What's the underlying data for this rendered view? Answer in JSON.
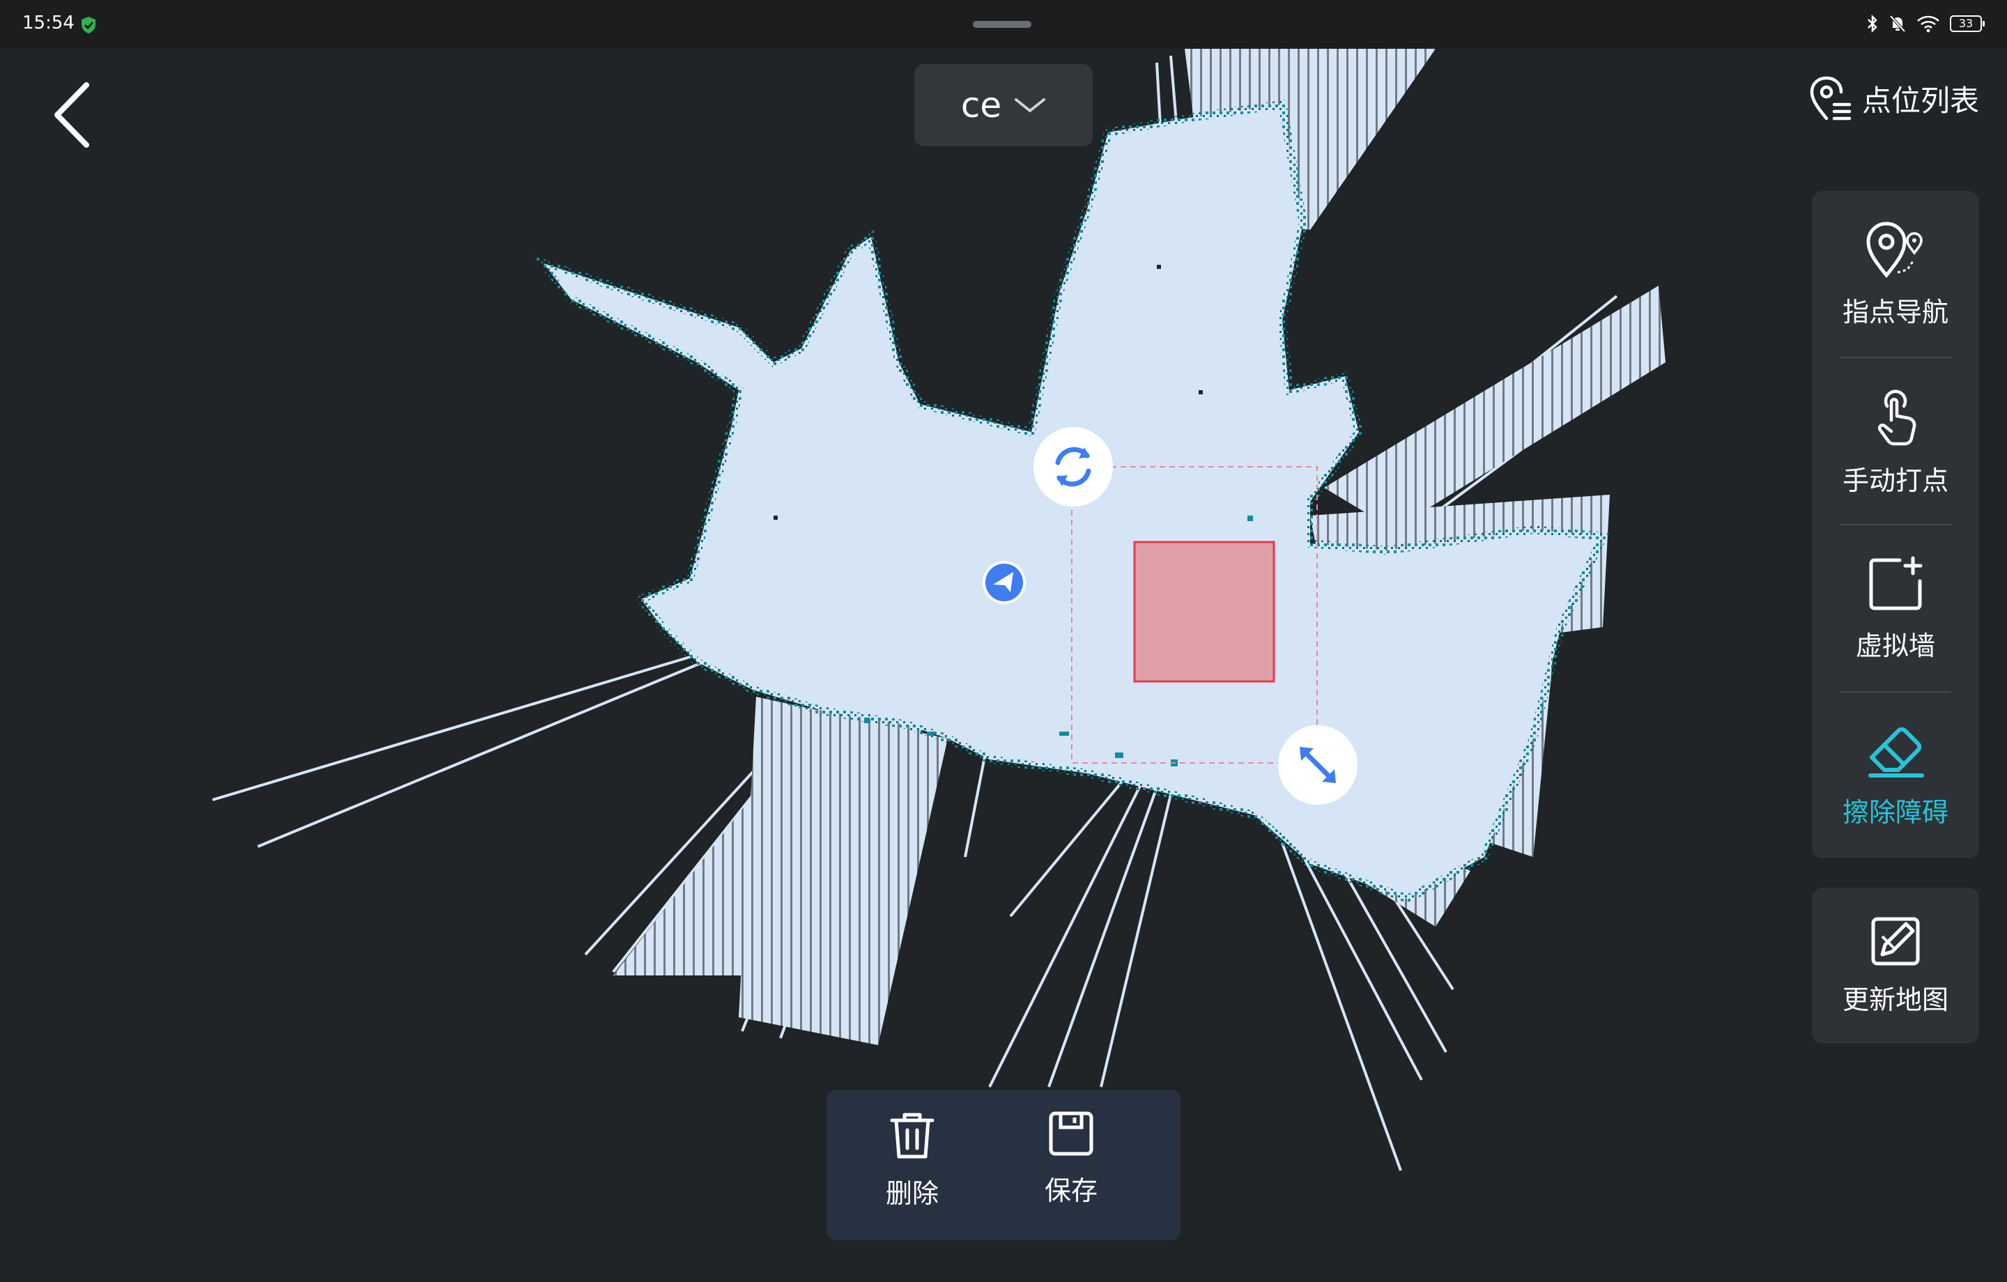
{
  "status_bar": {
    "time": "15:54",
    "battery": "33",
    "icons": [
      "shield-check-icon",
      "bluetooth-icon",
      "bell-off-icon",
      "wifi-icon",
      "battery-icon"
    ]
  },
  "header": {
    "back_icon": "chevron-left-icon",
    "map_selector": {
      "value": "ce",
      "icon": "chevron-down-icon"
    },
    "point_list": {
      "label": "点位列表",
      "icon": "map-pin-list-icon"
    }
  },
  "tools": [
    {
      "label": "指点导航",
      "icon": "pin-navigation-icon",
      "active": false
    },
    {
      "label": "手动打点",
      "icon": "hand-tap-icon",
      "active": false
    },
    {
      "label": "虚拟墙",
      "icon": "virtual-wall-add-icon",
      "active": false
    },
    {
      "label": "擦除障碍",
      "icon": "eraser-icon",
      "active": true
    }
  ],
  "update_map": {
    "label": "更新地图",
    "icon": "edit-map-icon"
  },
  "actions": {
    "delete": {
      "label": "删除",
      "icon": "trash-icon"
    },
    "save": {
      "label": "保存",
      "icon": "save-icon"
    }
  },
  "colors": {
    "background": "#202427",
    "map_free": "#d6e5f6",
    "map_edge": "#0f8f9a",
    "erase_zone": "#e0a0aa",
    "erase_zone_border": "#e23b49",
    "accent": "#27c3d8",
    "robot": "#3f7df0",
    "handle_icon": "#3f7df0"
  }
}
